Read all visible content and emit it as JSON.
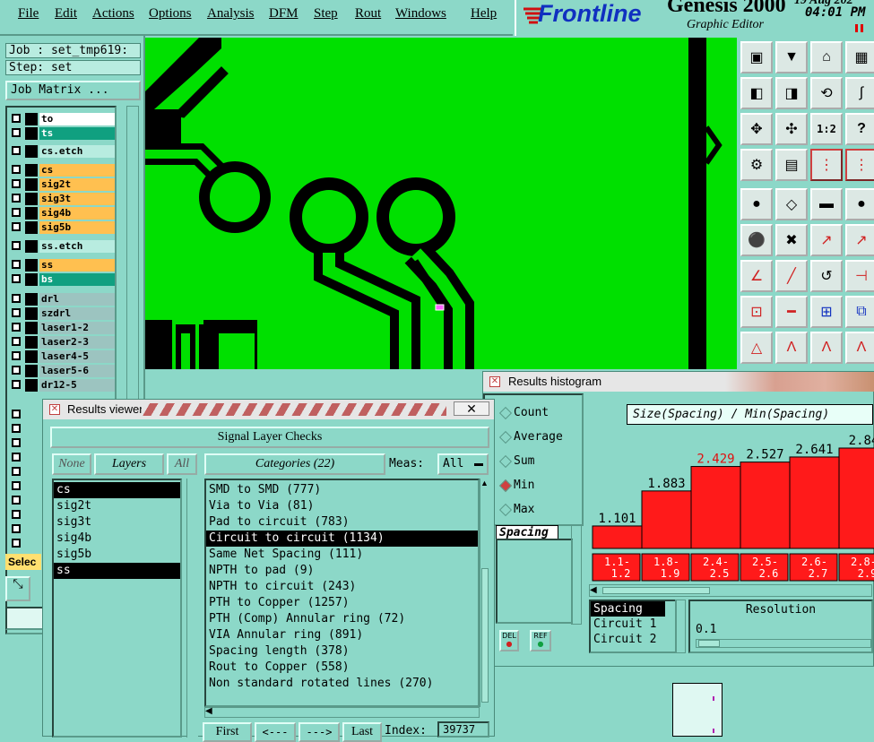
{
  "menu": [
    "File",
    "Edit",
    "Actions",
    "Options",
    "Analysis",
    "DFM",
    "Step",
    "Rout",
    "Windows",
    "Help"
  ],
  "brand": {
    "logo": "Frontline",
    "product": "Genesis 2000",
    "subtitle": "Graphic Editor",
    "date": "19 Aug 202",
    "time": "04:01 PM"
  },
  "job": {
    "job_label": "Job : set_tmp619:",
    "step_label": "Step: set",
    "matrix_button": "Job Matrix ..."
  },
  "layers": [
    {
      "name": "to",
      "color": "#ffffff"
    },
    {
      "name": "ts",
      "color": "#10a080"
    },
    {
      "name": "cs.etch",
      "color": "#b8ece0"
    },
    {
      "name": "cs",
      "color": "#ffc050"
    },
    {
      "name": "sig2t",
      "color": "#ffc050"
    },
    {
      "name": "sig3t",
      "color": "#ffc050"
    },
    {
      "name": "sig4b",
      "color": "#ffc050"
    },
    {
      "name": "sig5b",
      "color": "#ffc050"
    },
    {
      "name": "ss.etch",
      "color": "#b8ece0"
    },
    {
      "name": "ss",
      "color": "#ffc050"
    },
    {
      "name": "bs",
      "color": "#10a080"
    },
    {
      "name": "drl",
      "color": "#9cc4c0"
    },
    {
      "name": "szdrl",
      "color": "#9cc4c0"
    },
    {
      "name": "laser1-2",
      "color": "#9cc4c0"
    },
    {
      "name": "laser2-3",
      "color": "#9cc4c0"
    },
    {
      "name": "laser4-5",
      "color": "#9cc4c0"
    },
    {
      "name": "laser5-6",
      "color": "#9cc4c0"
    },
    {
      "name": "dr12-5",
      "color": "#9cc4c0"
    }
  ],
  "select_label": "Selec",
  "results_viewer": {
    "title": "Results viewer",
    "section": "Signal Layer Checks",
    "none_btn": "None",
    "layers_btn": "Layers",
    "all_btn": "All",
    "categories_btn": "Categories (22)",
    "meas_label": "Meas:",
    "meas_value": "All",
    "layer_items": [
      "cs",
      "sig2t",
      "sig3t",
      "sig4b",
      "sig5b",
      "ss"
    ],
    "selected_layers": [
      "cs",
      "ss"
    ],
    "category_items": [
      "SMD to SMD (777)",
      "Via to Via (81)",
      "Pad to circuit (783)",
      "Circuit to circuit (1134)",
      "Same Net Spacing (111)",
      "NPTH to pad (9)",
      "NPTH to circuit (243)",
      "PTH to Copper (1257)",
      "PTH (Comp) Annular ring (72)",
      "VIA Annular ring (891)",
      "Spacing length (378)",
      "Rout to Copper (558)",
      "Non standard rotated lines (270)"
    ],
    "selected_category": "Circuit to circuit (1134)",
    "nav": {
      "first": "First",
      "prev": "<---",
      "next": "--->",
      "last": "Last",
      "index_label": "Index:",
      "index_value": "39737"
    }
  },
  "histogram": {
    "title": "Results histogram",
    "options": [
      "Count",
      "Average",
      "Sum",
      "Min",
      "Max"
    ],
    "selected_option": "Min",
    "chart_title": "Size(Spacing) / Min(Spacing)",
    "attr_list_top": "Spacing",
    "attr_list": [
      "Spacing",
      "Circuit 1",
      "Circuit 2"
    ],
    "resolution_label": "Resolution",
    "resolution_value": "0.1",
    "del_btn": "DEL",
    "ref_btn": "REF"
  },
  "chart_data": {
    "type": "bar",
    "categories": [
      "1.1-1.2",
      "1.8-1.9",
      "2.4-2.5",
      "2.5-2.6",
      "2.6-2.7",
      "2.8-2.9"
    ],
    "values": [
      1.101,
      1.883,
      2.429,
      2.527,
      2.641,
      2.84
    ],
    "value_labels": [
      "1.101",
      "1.883",
      "2.429",
      "2.527",
      "2.641",
      "2.84"
    ],
    "bin_top": [
      "1.1-",
      "1.8-",
      "2.4-",
      "2.5-",
      "2.6-",
      "2.8-"
    ],
    "bin_bottom": [
      "1.2",
      "1.9",
      "2.5",
      "2.6",
      "2.7",
      "2.9"
    ],
    "highlight_index": 2,
    "title": "Size(Spacing) / Min(Spacing)",
    "colors": {
      "bar": "#ff1a1a",
      "highlight_label": "#e01010"
    }
  }
}
